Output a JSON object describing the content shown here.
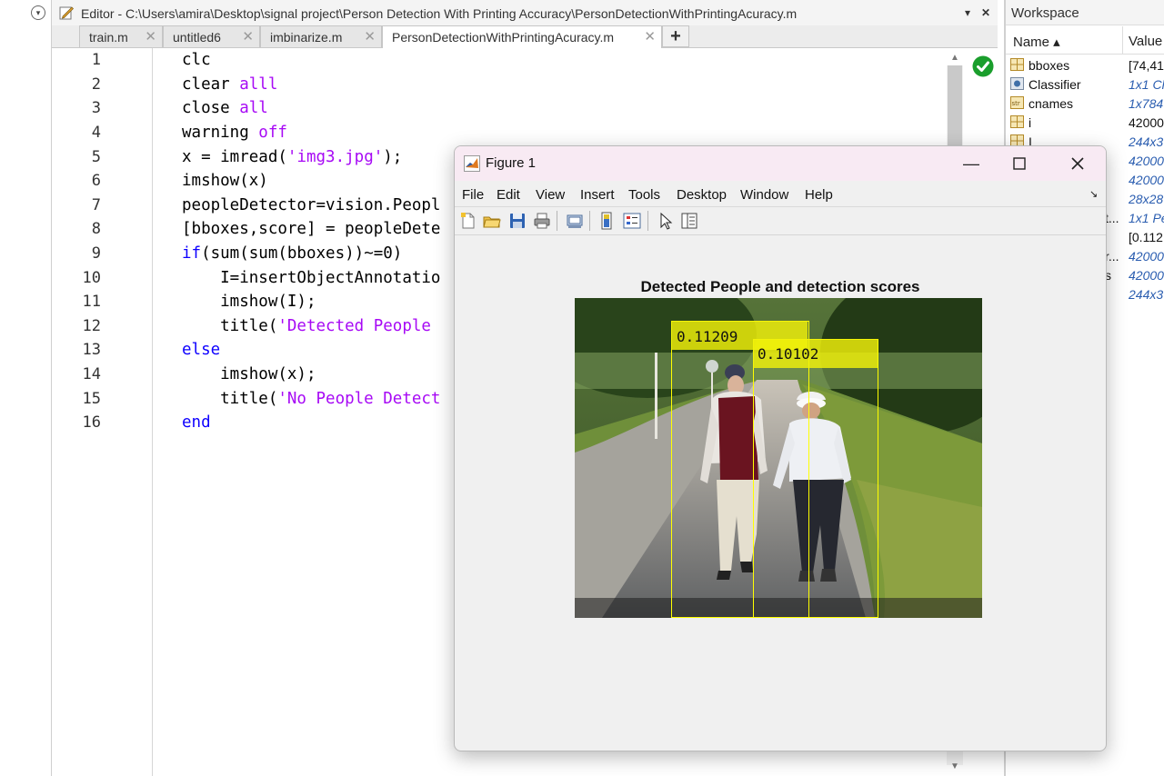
{
  "editor": {
    "title": "Editor - C:\\Users\\amira\\Desktop\\signal project\\Person Detection With Printing Accuracy\\PersonDetectionWithPrintingAcuracy.m",
    "tabs": [
      {
        "label": "train.m"
      },
      {
        "label": "untitled6"
      },
      {
        "label": "imbinarize.m"
      },
      {
        "label": "PersonDetectionWithPrintingAcuracy.m",
        "active": true
      }
    ],
    "add_tab": "+",
    "close_glyph": "✕",
    "menu_glyph": "▾",
    "line_numbers": [
      "1",
      "2",
      "3",
      "4",
      "5",
      "6",
      "7",
      "8",
      "9",
      "10",
      "11",
      "12",
      "13",
      "14",
      "15",
      "16"
    ],
    "code": [
      "clc",
      "clear alll",
      "close all",
      "warning off",
      "x = imread('img3.jpg');",
      "imshow(x)",
      "peopleDetector=vision.Peopl",
      "[bboxes,score] = peopleDete",
      "if(sum(sum(bboxes))~=0)",
      "    I=insertObjectAnnotatio",
      "    imshow(I);",
      "    title('Detected People ",
      "else",
      "    imshow(x);",
      "    title('No People Detect",
      "end"
    ]
  },
  "workspace": {
    "title": "Workspace",
    "col_name": "Name ▴",
    "col_value": "Value",
    "variables": [
      {
        "name": "bboxes",
        "value": "[74,41,",
        "icon": "matrix-icon",
        "italic": false
      },
      {
        "name": "Classifier",
        "value": "1x1 Cl",
        "icon": "object-icon",
        "italic": true
      },
      {
        "name": "cnames",
        "value": "1x784",
        "icon": "string-icon",
        "italic": true
      },
      {
        "name": "i",
        "value": "42000",
        "icon": "matrix-icon",
        "italic": false
      },
      {
        "name": "I",
        "value": "244x3",
        "icon": "matrix-icon",
        "italic": true
      },
      {
        "name": "",
        "value": "42000",
        "icon": "",
        "italic": true
      },
      {
        "name": "",
        "value": "42000",
        "icon": "",
        "italic": true
      },
      {
        "name": "",
        "value": "28x28",
        "icon": "",
        "italic": true
      },
      {
        "name": "t...",
        "value": "1x1 Pe",
        "icon": "",
        "italic": true
      },
      {
        "name": "",
        "value": "[0.112",
        "icon": "",
        "italic": false
      },
      {
        "name": "r...",
        "value": "42000",
        "icon": "",
        "italic": true
      },
      {
        "name": "s",
        "value": "42000",
        "icon": "",
        "italic": true
      },
      {
        "name": "",
        "value": "244x3",
        "icon": "",
        "italic": true
      }
    ]
  },
  "figure": {
    "title": "Figure 1",
    "menus": [
      "File",
      "Edit",
      "View",
      "Insert",
      "Tools",
      "Desktop",
      "Window",
      "Help"
    ],
    "axes_title": "Detected People and detection scores",
    "detections": [
      {
        "score": "0.11209"
      },
      {
        "score": "0.10102"
      }
    ],
    "annotation_color": "#ffff00"
  },
  "colors": {
    "keyword": "#0e00ff",
    "string": "#a709f5",
    "status_ok": "#1a9e2c"
  }
}
